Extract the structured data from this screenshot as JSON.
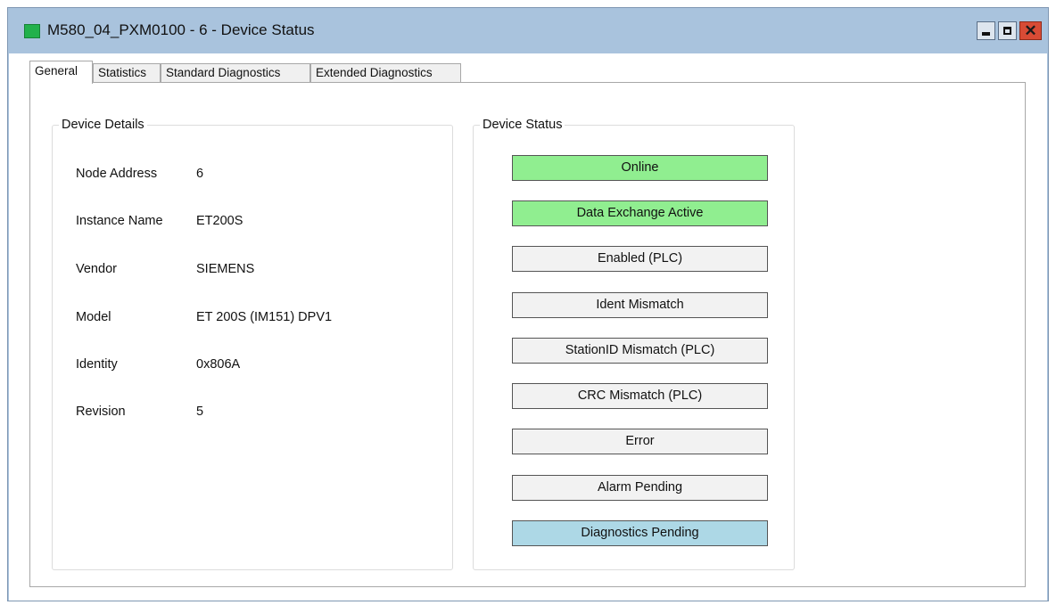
{
  "window": {
    "title": "M580_04_PXM0100 - 6 - Device Status",
    "icon_color": "#22b14c",
    "controls": {
      "minimize": "minimize-icon",
      "maximize": "maximize-icon",
      "close": "close-icon"
    }
  },
  "tabs": [
    {
      "label": "General",
      "active": true
    },
    {
      "label": "Statistics",
      "active": false
    },
    {
      "label": "Standard Diagnostics",
      "active": false
    },
    {
      "label": "Extended Diagnostics",
      "active": false
    }
  ],
  "device_details": {
    "title": "Device Details",
    "rows": [
      {
        "label": "Node Address",
        "value": "6"
      },
      {
        "label": "Instance Name",
        "value": "ET200S"
      },
      {
        "label": "Vendor",
        "value": "SIEMENS"
      },
      {
        "label": "Model",
        "value": "ET 200S (IM151) DPV1"
      },
      {
        "label": "Identity",
        "value": "0x806A"
      },
      {
        "label": "Revision",
        "value": "5"
      }
    ]
  },
  "device_status": {
    "title": "Device Status",
    "indicators": [
      {
        "label": "Online",
        "color": "#90ee90"
      },
      {
        "label": "Data Exchange Active",
        "color": "#90ee90"
      },
      {
        "label": "Enabled (PLC)",
        "color": "#f2f2f2"
      },
      {
        "label": "Ident Mismatch",
        "color": "#f2f2f2"
      },
      {
        "label": "StationID Mismatch (PLC)",
        "color": "#f2f2f2"
      },
      {
        "label": "CRC Mismatch (PLC)",
        "color": "#f2f2f2"
      },
      {
        "label": "Error",
        "color": "#f2f2f2"
      },
      {
        "label": "Alarm Pending",
        "color": "#f2f2f2"
      },
      {
        "label": "Diagnostics Pending",
        "color": "#add8e6"
      }
    ]
  }
}
